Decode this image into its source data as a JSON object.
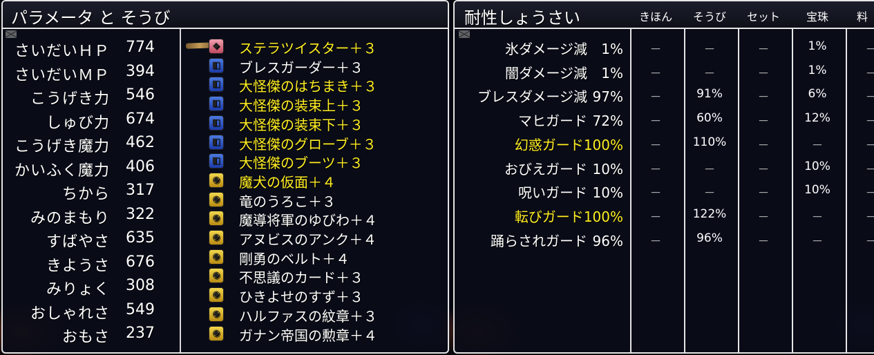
{
  "left": {
    "title": "パラメータ と そうび",
    "stats": [
      {
        "label": "さいだいＨＰ",
        "value": "774"
      },
      {
        "label": "さいだいＭＰ",
        "value": "394"
      },
      {
        "label": "こうげき力",
        "value": "546"
      },
      {
        "label": "しゅび力",
        "value": "674"
      },
      {
        "label": "こうげき魔力",
        "value": "462"
      },
      {
        "label": "かいふく魔力",
        "value": "406"
      },
      {
        "label": "ちから",
        "value": "317"
      },
      {
        "label": "みのまもり",
        "value": "322"
      },
      {
        "label": "すばやさ",
        "value": "635"
      },
      {
        "label": "きようさ",
        "value": "676"
      },
      {
        "label": "みりょく",
        "value": "308"
      },
      {
        "label": "おしゃれさ",
        "value": "549"
      },
      {
        "label": "おもさ",
        "value": "237"
      }
    ],
    "equipment": [
      {
        "name": "ステラツイスター＋３",
        "highlight": true,
        "icon": "pink-weapon-icon"
      },
      {
        "name": "ブレスガーダー＋３",
        "highlight": false,
        "icon": "blue-shield-icon"
      },
      {
        "name": "大怪傑のはちまき＋３",
        "highlight": true,
        "icon": "blue-head-icon"
      },
      {
        "name": "大怪傑の装束上＋３",
        "highlight": true,
        "icon": "blue-body-top-icon"
      },
      {
        "name": "大怪傑の装束下＋３",
        "highlight": true,
        "icon": "blue-body-bottom-icon"
      },
      {
        "name": "大怪傑のグローブ＋３",
        "highlight": true,
        "icon": "blue-glove-icon"
      },
      {
        "name": "大怪傑のブーツ＋３",
        "highlight": true,
        "icon": "blue-boots-icon"
      },
      {
        "name": "魔犬の仮面＋４",
        "highlight": true,
        "icon": "gold-face-icon"
      },
      {
        "name": "竜のうろこ＋３",
        "highlight": false,
        "icon": "gold-scale-icon"
      },
      {
        "name": "魔導将軍のゆびわ＋４",
        "highlight": false,
        "icon": "gold-ring-icon"
      },
      {
        "name": "アヌビスのアンク＋４",
        "highlight": false,
        "icon": "gold-ankh-icon"
      },
      {
        "name": "剛勇のベルト＋４",
        "highlight": false,
        "icon": "gold-belt-icon"
      },
      {
        "name": "不思議のカード＋３",
        "highlight": false,
        "icon": "gold-card-icon"
      },
      {
        "name": "ひきよせのすず＋３",
        "highlight": false,
        "icon": "gold-bell-icon"
      },
      {
        "name": "ハルファスの紋章＋３",
        "highlight": false,
        "icon": "gold-crest-icon"
      },
      {
        "name": "ガナン帝国の勲章＋４",
        "highlight": false,
        "icon": "gold-medal-icon"
      }
    ]
  },
  "right": {
    "title": "耐性しょうさい",
    "columns": [
      "きほん",
      "そうび",
      "セット",
      "宝珠",
      "料"
    ],
    "rows": [
      {
        "label": "氷ダメージ減",
        "total": "1%",
        "cells": [
          "－",
          "－",
          "－",
          "1%",
          "－"
        ],
        "highlight": false
      },
      {
        "label": "闇ダメージ減",
        "total": "1%",
        "cells": [
          "－",
          "－",
          "－",
          "1%",
          "－"
        ],
        "highlight": false
      },
      {
        "label": "ブレスダメージ減",
        "total": "97%",
        "cells": [
          "－",
          "91%",
          "－",
          "6%",
          "－"
        ],
        "highlight": false
      },
      {
        "label": "マヒガード",
        "total": "72%",
        "cells": [
          "－",
          "60%",
          "－",
          "12%",
          "－"
        ],
        "highlight": false
      },
      {
        "label": "幻惑ガード",
        "total": "100%",
        "cells": [
          "－",
          "110%",
          "－",
          "－",
          "－"
        ],
        "highlight": true
      },
      {
        "label": "おびえガード",
        "total": "10%",
        "cells": [
          "－",
          "－",
          "－",
          "10%",
          "－"
        ],
        "highlight": false
      },
      {
        "label": "呪いガード",
        "total": "10%",
        "cells": [
          "－",
          "－",
          "－",
          "10%",
          "－"
        ],
        "highlight": false
      },
      {
        "label": "転びガード",
        "total": "100%",
        "cells": [
          "－",
          "122%",
          "－",
          "－",
          "－"
        ],
        "highlight": true
      },
      {
        "label": "踊らされガード",
        "total": "96%",
        "cells": [
          "－",
          "96%",
          "－",
          "－",
          "－"
        ],
        "highlight": false
      }
    ]
  }
}
